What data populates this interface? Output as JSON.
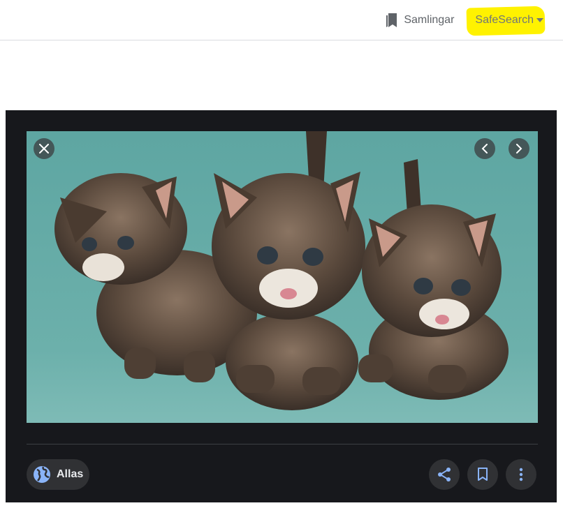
{
  "header": {
    "collections_label": "Samlingar",
    "safesearch_label": "SafeSearch"
  },
  "viewer": {
    "image_alt": "Tre kattungar",
    "usage_rights_label": "Allas"
  },
  "colors": {
    "highlight": "#fff200",
    "viewer_background": "#17181c",
    "accent_icon": "#8ab4f8",
    "photo_background": "#5ea6a2"
  }
}
